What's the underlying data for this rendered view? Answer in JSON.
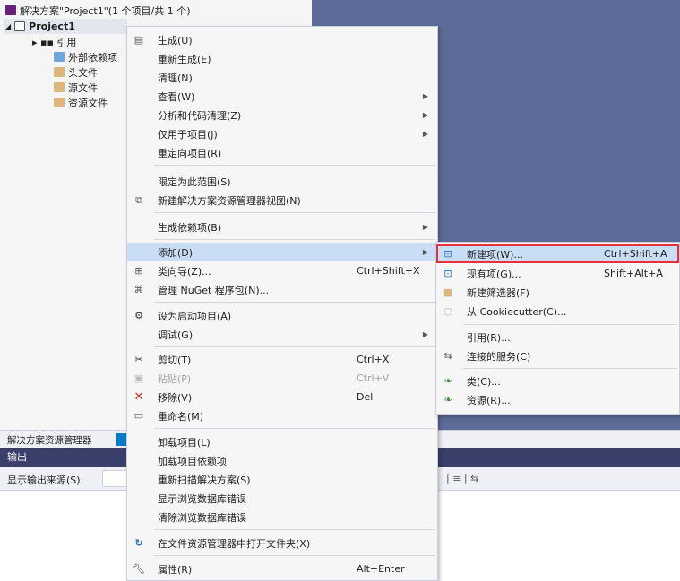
{
  "solution_explorer": {
    "solution_label": "解决方案\"Project1\"(1 个项目/共 1 个)",
    "project_label": "Project1",
    "items": [
      {
        "label": "▸ ▪▪ 引用",
        "icon": "references-icon"
      },
      {
        "label": "外部依赖项",
        "icon": "external-deps-icon"
      },
      {
        "label": "头文件",
        "icon": "folder-icon"
      },
      {
        "label": "源文件",
        "icon": "folder-icon"
      },
      {
        "label": "资源文件",
        "icon": "folder-icon"
      }
    ]
  },
  "bottom_tabs": {
    "solution_explorer_tab": "解决方案资源管理器"
  },
  "output": {
    "title": "输出",
    "source_label": "显示输出来源(S):",
    "tools": "| ≡ | ⇆"
  },
  "context_menu": {
    "items": [
      {
        "label": "生成(U)",
        "icon": "build-icon"
      },
      {
        "label": "重新生成(E)"
      },
      {
        "label": "清理(N)"
      },
      {
        "label": "查看(W)",
        "submenu": true
      },
      {
        "label": "分析和代码清理(Z)",
        "submenu": true
      },
      {
        "label": "仅用于项目(J)",
        "submenu": true
      },
      {
        "label": "重定向项目(R)"
      },
      {
        "label": "限定为此范围(S)"
      },
      {
        "label": "新建解决方案资源管理器视图(N)",
        "icon": "new-view-icon"
      },
      {
        "label": "生成依赖项(B)",
        "submenu": true
      },
      {
        "label": "添加(D)",
        "submenu": true,
        "highlighted": true
      },
      {
        "label": "类向导(Z)...",
        "shortcut": "Ctrl+Shift+X",
        "icon": "class-wizard-icon"
      },
      {
        "label": "管理 NuGet 程序包(N)...",
        "icon": "nuget-icon"
      },
      {
        "label": "设为启动项目(A)",
        "icon": "gear-icon"
      },
      {
        "label": "调试(G)",
        "submenu": true
      },
      {
        "label": "剪切(T)",
        "shortcut": "Ctrl+X",
        "icon": "scissors-icon"
      },
      {
        "label": "粘贴(P)",
        "shortcut": "Ctrl+V",
        "icon": "paste-icon",
        "disabled": true
      },
      {
        "label": "移除(V)",
        "shortcut": "Del",
        "icon": "close-icon"
      },
      {
        "label": "重命名(M)",
        "icon": "rename-icon"
      },
      {
        "label": "卸载项目(L)"
      },
      {
        "label": "加载项目依赖项"
      },
      {
        "label": "重新扫描解决方案(S)"
      },
      {
        "label": "显示浏览数据库错误"
      },
      {
        "label": "清除浏览数据库错误"
      },
      {
        "label": "在文件资源管理器中打开文件夹(X)",
        "icon": "open-folder-icon"
      },
      {
        "label": "属性(R)",
        "shortcut": "Alt+Enter",
        "icon": "wrench-icon"
      }
    ]
  },
  "add_submenu": {
    "items": [
      {
        "label": "新建项(W)...",
        "shortcut": "Ctrl+Shift+A",
        "icon": "new-item-icon",
        "highlighted": true
      },
      {
        "label": "现有项(G)...",
        "shortcut": "Shift+Alt+A",
        "icon": "existing-item-icon"
      },
      {
        "label": "新建筛选器(F)",
        "icon": "new-filter-icon"
      },
      {
        "label": "从 Cookiecutter(C)...",
        "icon": "cookiecutter-icon"
      },
      {
        "label": "引用(R)..."
      },
      {
        "label": "连接的服务(C)",
        "icon": "connected-services-icon"
      },
      {
        "label": "类(C)...",
        "icon": "class-icon"
      },
      {
        "label": "资源(R)...",
        "icon": "resource-icon"
      }
    ]
  },
  "colors": {
    "accent": "#007acc",
    "highlight": "#c9def5",
    "outline_red": "#e8303a",
    "editor_bg": "#5d6b99",
    "output_title_bg": "#3a3f6b"
  }
}
